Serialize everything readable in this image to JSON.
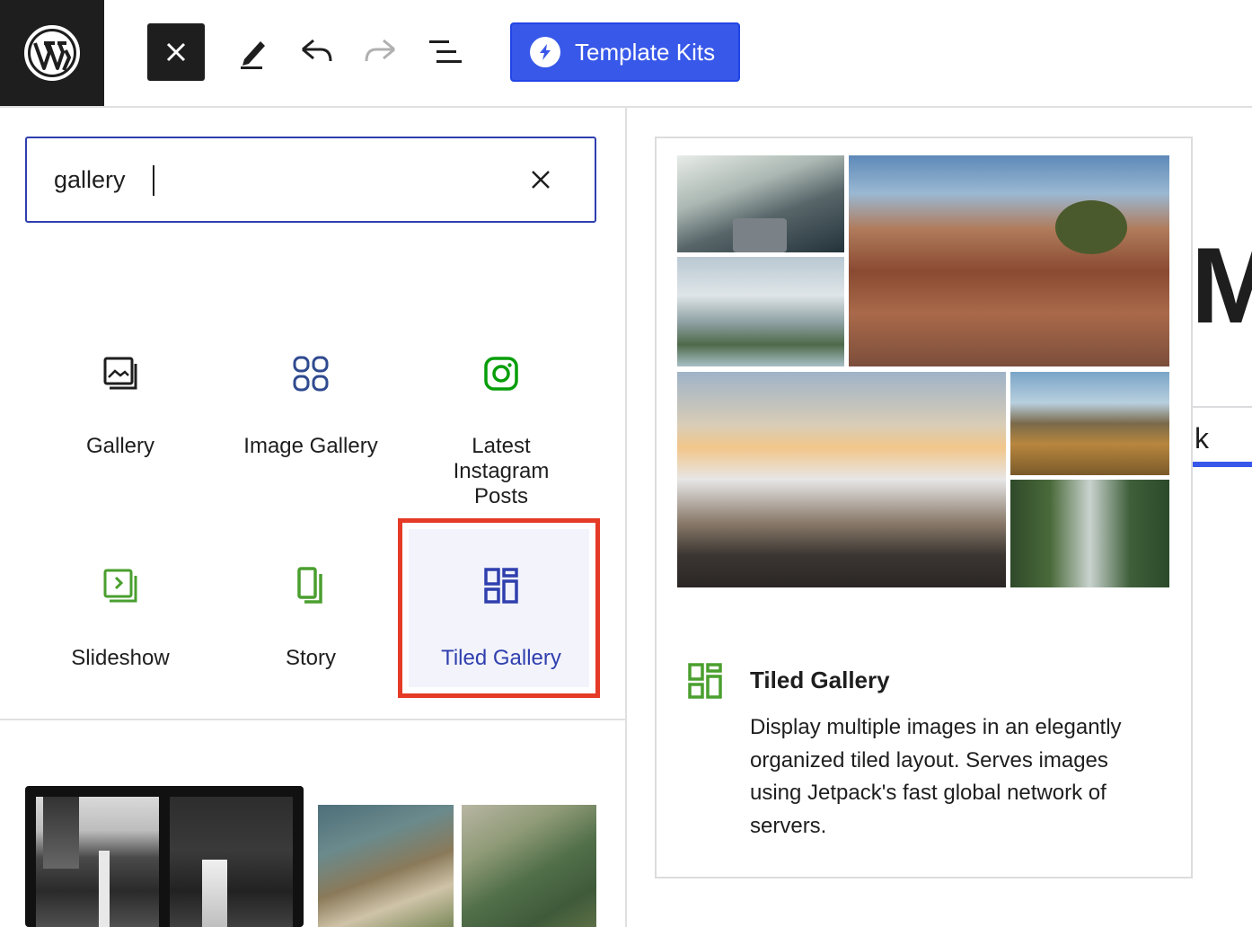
{
  "toolbar": {
    "template_kits_label": "Template Kits"
  },
  "search": {
    "value": "gallery"
  },
  "blocks": [
    {
      "label": "Gallery"
    },
    {
      "label": "Image Gallery"
    },
    {
      "label": "Latest Instagram Posts"
    },
    {
      "label": "Slideshow"
    },
    {
      "label": "Story"
    },
    {
      "label": "Tiled Gallery"
    }
  ],
  "preview": {
    "title": "Tiled Gallery",
    "description": "Display multiple images in an elegantly organized tiled layout. Serves images using Jetpack's fast global network of servers."
  },
  "background": {
    "heading_fragment": "M",
    "text_fragment": "k"
  },
  "colors": {
    "accent": "#3858e9",
    "selection_outline": "#e43a26",
    "jetpack_green": "#069e08",
    "icon_green": "#4a9f2f",
    "icon_blue": "#2f3fae"
  }
}
